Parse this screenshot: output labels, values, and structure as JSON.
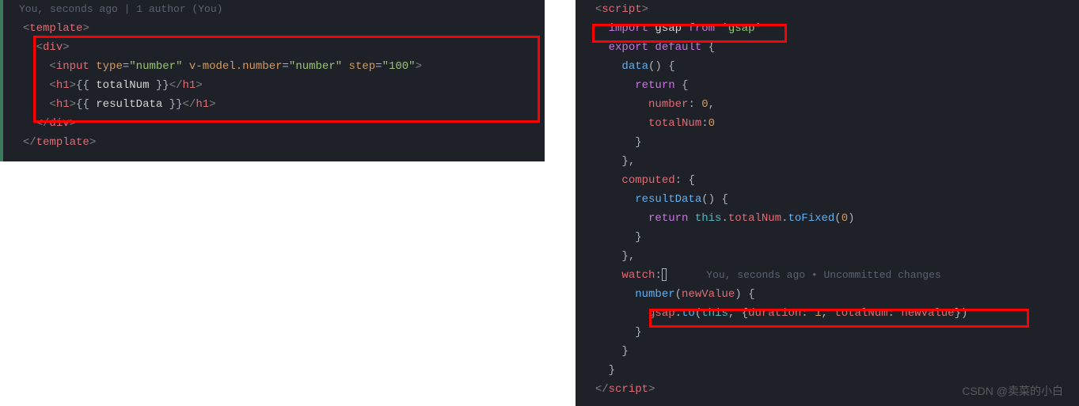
{
  "left": {
    "gitlens": "You, seconds ago | 1 author (You)",
    "l1_open": "<",
    "l1_tag": "template",
    "l1_close": ">",
    "l2_open": "<",
    "l2_tag": "div",
    "l2_close": ">",
    "l3_open": "<",
    "l3_tag": "input",
    "l3_sp": " ",
    "l3_a1": "type",
    "l3_eq": "=",
    "l3_v1": "\"number\"",
    "l3_a2": "v-model.number",
    "l3_v2": "\"number\"",
    "l3_a3": "step",
    "l3_v3": "\"100\"",
    "l3_close": ">",
    "l4_open": "<",
    "l4_tag": "h1",
    "l4_close": ">",
    "l4_mo": "{{ ",
    "l4_var": "totalNum",
    "l4_mc": " }}",
    "l4_endopen": "</",
    "l4_endtag": "h1",
    "l4_endclose": ">",
    "l5_var": "resultData",
    "l6_open": "</",
    "l6_tag": "div",
    "l6_close": ">",
    "l7_open": "</",
    "l7_tag": "template",
    "l7_close": ">"
  },
  "right": {
    "r1_open": "<",
    "r1_tag": "script",
    "r1_close": ">",
    "r2_import": "import",
    "r2_gsap": " gsap ",
    "r2_from": "from",
    "r2_sp": " ",
    "r2_str": "'gsap'",
    "r3_export": "export",
    "r3_default": " default",
    "r3_brace": " {",
    "r4_data": "data",
    "r4_par": "()",
    "r4_brace": " {",
    "r5_return": "return",
    "r5_brace": " {",
    "r6_key": "number",
    "r6_colon": ": ",
    "r6_val": "0",
    "r6_comma": ",",
    "r7_key": "totalNum",
    "r7_colon": ":",
    "r7_val": "0",
    "r8_brace": "}",
    "r9_brace": "}",
    "r9_comma": ",",
    "r10_computed": "computed",
    "r10_colon": ": {",
    "r11_func": "resultData",
    "r11_par": "()",
    "r11_brace": " {",
    "r12_return": "return",
    "r12_sp": " ",
    "r12_this": "this",
    "r12_dot1": ".",
    "r12_prop": "totalNum",
    "r12_dot2": ".",
    "r12_method": "toFixed",
    "r12_par": "(",
    "r12_arg": "0",
    "r12_parc": ")",
    "r13_brace": "}",
    "r14_brace": "}",
    "r14_comma": ",",
    "r15_watch": "watch",
    "r15_colon": ":",
    "r15_gitlens": "You, seconds ago • Uncommitted changes",
    "r16_func": "number",
    "r16_paro": "(",
    "r16_param": "newValue",
    "r16_parc": ")",
    "r16_brace": " {",
    "r17_gsap": "gsap",
    "r17_dot": ".",
    "r17_to": "to",
    "r17_po": "(",
    "r17_this": "this",
    "r17_comma": ", {",
    "r17_dur": "duration",
    "r17_colon1": ": ",
    "r17_durv": "1",
    "r17_c2": ", ",
    "r17_tn": "totalNum",
    "r17_colon2": ": ",
    "r17_nv": "newValue",
    "r17_close": "})",
    "r18_brace": "}",
    "r19_brace": "}",
    "r20_brace": "}",
    "r21_open": "</",
    "r21_tag": "script",
    "r21_close": ">"
  },
  "watermark": "CSDN @卖菜的小白"
}
